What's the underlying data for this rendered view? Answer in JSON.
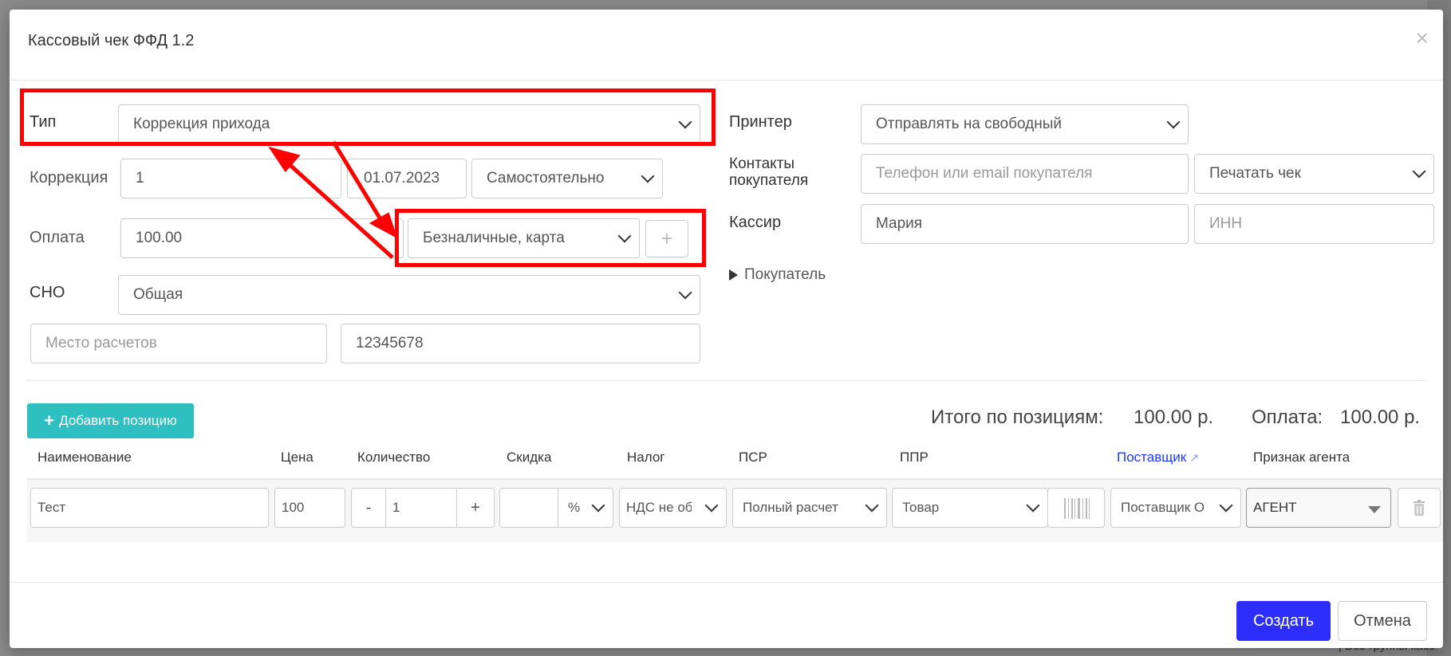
{
  "modal": {
    "title": "Кассовый чек ФФД 1.2",
    "close": "×"
  },
  "form": {
    "type": {
      "label": "Тип",
      "value": "Коррекция прихода"
    },
    "correction": {
      "label": "Коррекция",
      "number": "1",
      "date": "01.07.2023",
      "kind": "Самостоятельно"
    },
    "payment": {
      "label": "Оплата",
      "amount": "100.00",
      "method": "Безналичные, карта",
      "add": "+"
    },
    "sno": {
      "label": "СНО",
      "value": "Общая"
    },
    "place": {
      "placeholder": "Место расчетов",
      "value": "12345678"
    },
    "printer": {
      "label": "Принтер",
      "value": "Отправлять на свободный"
    },
    "contacts": {
      "label_line1": "Контакты",
      "label_line2": "покупателя",
      "placeholder": "Телефон или email покупателя",
      "print_mode": "Печатать чек"
    },
    "cashier": {
      "label": "Кассир",
      "name": "Мария",
      "inn_placeholder": "ИНН"
    },
    "buyer_toggle": "Покупатель"
  },
  "items": {
    "add_button": "Добавить позицию",
    "totals": {
      "items_label": "Итого по позициям:",
      "items_value": "100.00 р.",
      "payment_label": "Оплата:",
      "payment_value": "100.00 р."
    },
    "columns": [
      "Наименование",
      "Цена",
      "Количество",
      "Скидка",
      "Налог",
      "ПСР",
      "ППР",
      "Поставщик",
      "Признак агента"
    ],
    "row": {
      "name": "Тест",
      "price": "100",
      "qty_minus": "-",
      "qty": "1",
      "qty_plus": "+",
      "discount": "",
      "discount_unit": "%",
      "tax": "НДС не облагается",
      "psr": "Полный расчет",
      "ppr": "Товар",
      "supplier": "Поставщик О",
      "agent": "АГЕНТ"
    }
  },
  "footer": {
    "create": "Создать",
    "cancel": "Отмена"
  },
  "backdrop": {
    "text": "| Все группы касс",
    "p": "p"
  },
  "colors": {
    "primary": "#2e2efa",
    "teal": "#2ebfc1",
    "annotation": "#ff0000",
    "link": "#1c37ff"
  }
}
